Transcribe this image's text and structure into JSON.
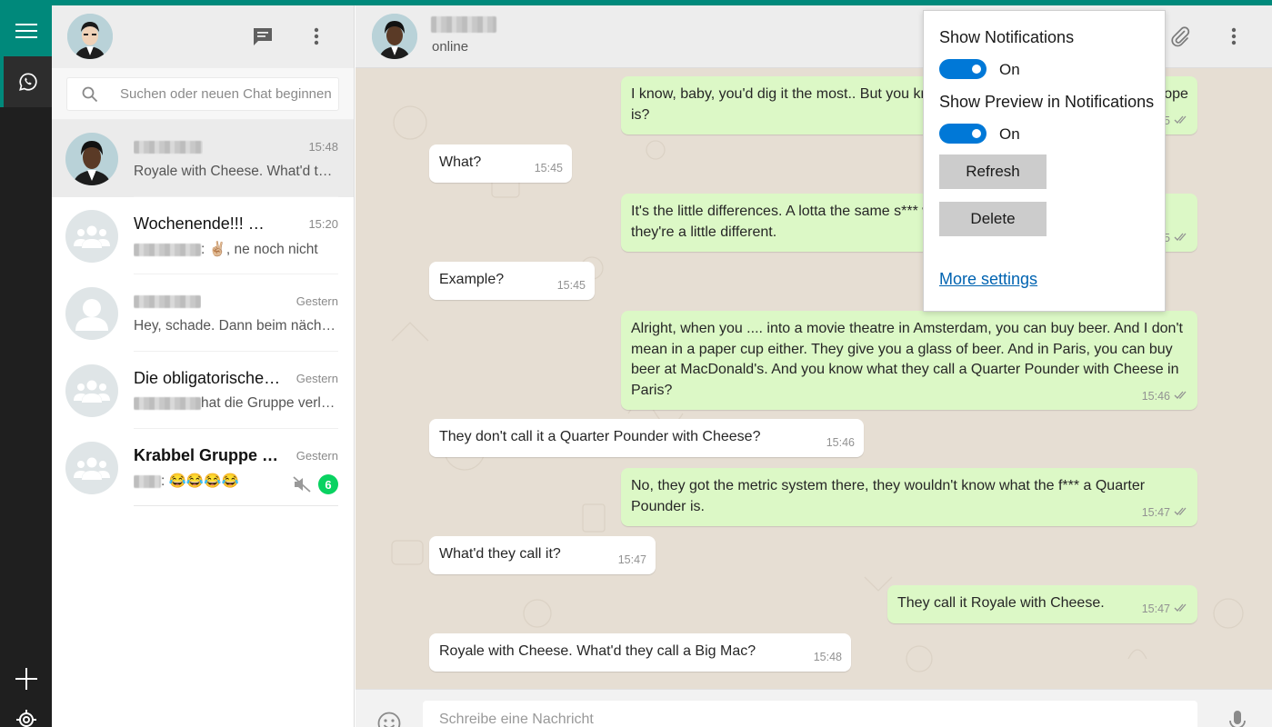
{
  "colors": {
    "accent": "#00897b",
    "rail_bg": "#1f1f1f",
    "bubble_out": "#dcf8c6",
    "bubble_in": "#ffffff",
    "chat_bg": "#e6ded3",
    "unread_badge": "#09d261",
    "toggle_on": "#0078d7",
    "link": "#0063b1"
  },
  "rail": {
    "items": [
      {
        "icon": "hamburger-menu-icon"
      },
      {
        "icon": "whatsapp-icon"
      },
      {
        "icon": "plus-icon"
      },
      {
        "icon": "gear-icon"
      }
    ]
  },
  "sidebar": {
    "header_icons": [
      "new-chat-icon",
      "more-vertical-icon"
    ],
    "search_placeholder": "Suchen oder neuen Chat beginnen",
    "chats": [
      {
        "name": "",
        "name_blurred": true,
        "time": "15:48",
        "preview": "Royale with Cheese. What'd they call a Big Mac?",
        "sender_blurred": false,
        "active": true,
        "avatar": "avatar-photo"
      },
      {
        "name": "Wochenende!!! 😊😊",
        "name_blurred": false,
        "time": "15:20",
        "preview": ": ✌🏼, ne noch nicht",
        "sender_blurred": true,
        "active": false,
        "avatar": "group-icon"
      },
      {
        "name": "",
        "name_blurred": true,
        "time": "Gestern",
        "preview": "Hey, schade. Dann beim nächsten Mal",
        "sender_blurred": false,
        "active": false,
        "avatar": "person-icon"
      },
      {
        "name": "Die obligatorische Gruppe",
        "name_blurred": false,
        "time": "Gestern",
        "preview": "hat die Gruppe verlassen",
        "sender_blurred": true,
        "active": false,
        "avatar": "group-icon"
      },
      {
        "name": "Krabbel Gruppe Sonnenschein",
        "name_blurred": false,
        "bold": true,
        "time": "Gestern",
        "preview": ": 😂😂😂😂",
        "sender_blurred": true,
        "active": false,
        "avatar": "group-icon",
        "muted": true,
        "unread": "6"
      }
    ]
  },
  "conversation": {
    "contact_name_blurred": true,
    "status": "online",
    "header_icons": [
      "attachment-icon",
      "more-vertical-icon"
    ],
    "messages": [
      {
        "dir": "out",
        "text": "I know, baby, you'd dig it the most.. But you know what the funniest thing about Europe is?",
        "time": "15:45",
        "ticks": true
      },
      {
        "dir": "in",
        "text": "What?",
        "time": "15:45"
      },
      {
        "dir": "out",
        "text": "It's the little differences. A lotta the same s*** we got here, they got there, but there they're a little different.",
        "time": "15:45",
        "ticks": true
      },
      {
        "dir": "in",
        "text": "Example?",
        "time": "15:45"
      },
      {
        "dir": "out",
        "text": "Alright, when you .... into a movie theatre in Amsterdam, you can buy beer. And I don't mean in a paper cup either. They give you a glass of beer. And in Paris, you can buy beer at MacDonald's. And you know what they call a Quarter Pounder with Cheese in Paris?",
        "time": "15:46",
        "ticks": true
      },
      {
        "dir": "in",
        "text": "They don't call it a Quarter Pounder with Cheese?",
        "time": "15:46"
      },
      {
        "dir": "out",
        "text": "No, they got the metric system there, they wouldn't know what the f*** a Quarter Pounder is.",
        "time": "15:47",
        "ticks": true
      },
      {
        "dir": "in",
        "text": "What'd they call it?",
        "time": "15:47"
      },
      {
        "dir": "out",
        "text": "They call it Royale with Cheese.",
        "time": "15:47",
        "ticks": true
      },
      {
        "dir": "in",
        "text": "Royale with Cheese. What'd they call a Big Mac?",
        "time": "15:48"
      }
    ],
    "composer_placeholder": "Schreibe eine Nachricht",
    "composer_icons": [
      "emoji-icon",
      "microphone-icon"
    ]
  },
  "popup": {
    "show_notifications_label": "Show Notifications",
    "show_notifications_state": "On",
    "show_preview_label": "Show Preview in Notifications",
    "show_preview_state": "On",
    "refresh_label": "Refresh",
    "delete_label": "Delete",
    "more_settings_label": "More settings"
  }
}
